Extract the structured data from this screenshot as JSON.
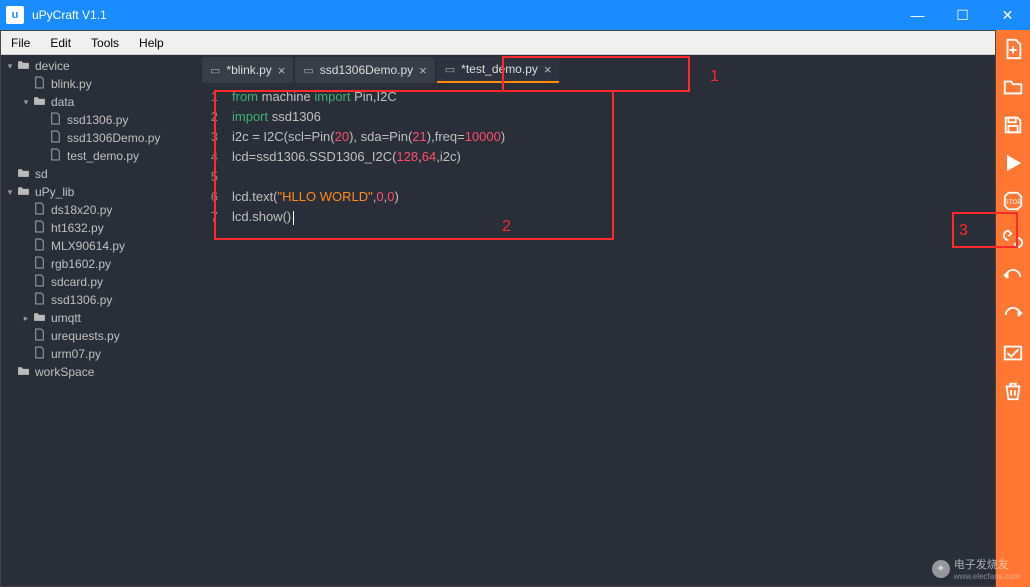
{
  "window": {
    "title": "uPyCraft V1.1",
    "controls": {
      "min": "—",
      "max": "☐",
      "close": "✕"
    }
  },
  "menu": [
    "File",
    "Edit",
    "Tools",
    "Help"
  ],
  "tree": [
    {
      "depth": 0,
      "arrow": "▾",
      "icon": "folder",
      "label": "device"
    },
    {
      "depth": 1,
      "arrow": "",
      "icon": "file",
      "label": "blink.py"
    },
    {
      "depth": 1,
      "arrow": "▾",
      "icon": "folder",
      "label": "data"
    },
    {
      "depth": 2,
      "arrow": "",
      "icon": "file",
      "label": "ssd1306.py"
    },
    {
      "depth": 2,
      "arrow": "",
      "icon": "file",
      "label": "ssd1306Demo.py"
    },
    {
      "depth": 2,
      "arrow": "",
      "icon": "file",
      "label": "test_demo.py"
    },
    {
      "depth": 0,
      "arrow": "",
      "icon": "folder",
      "label": "sd"
    },
    {
      "depth": 0,
      "arrow": "▾",
      "icon": "folder",
      "label": "uPy_lib"
    },
    {
      "depth": 1,
      "arrow": "",
      "icon": "file",
      "label": "ds18x20.py"
    },
    {
      "depth": 1,
      "arrow": "",
      "icon": "file",
      "label": "ht1632.py"
    },
    {
      "depth": 1,
      "arrow": "",
      "icon": "file",
      "label": "MLX90614.py"
    },
    {
      "depth": 1,
      "arrow": "",
      "icon": "file",
      "label": "rgb1602.py"
    },
    {
      "depth": 1,
      "arrow": "",
      "icon": "file",
      "label": "sdcard.py"
    },
    {
      "depth": 1,
      "arrow": "",
      "icon": "file",
      "label": "ssd1306.py"
    },
    {
      "depth": 1,
      "arrow": "▸",
      "icon": "folder",
      "label": "umqtt"
    },
    {
      "depth": 1,
      "arrow": "",
      "icon": "file",
      "label": "urequests.py"
    },
    {
      "depth": 1,
      "arrow": "",
      "icon": "file",
      "label": "urm07.py"
    },
    {
      "depth": 0,
      "arrow": "",
      "icon": "folder",
      "label": "workSpace"
    }
  ],
  "tabs": [
    {
      "label": "*blink.py",
      "active": false
    },
    {
      "label": "ssd1306Demo.py",
      "active": false
    },
    {
      "label": "*test_demo.py",
      "active": true
    }
  ],
  "code": {
    "lines": [
      [
        {
          "t": "from ",
          "c": "kw"
        },
        {
          "t": "machine ",
          "c": "id"
        },
        {
          "t": "import ",
          "c": "kw"
        },
        {
          "t": "Pin,I2C",
          "c": "id"
        }
      ],
      [
        {
          "t": "import ",
          "c": "kw"
        },
        {
          "t": "ssd1306",
          "c": "id"
        }
      ],
      [
        {
          "t": "i2c = I2C(scl=Pin(",
          "c": "id"
        },
        {
          "t": "20",
          "c": "num"
        },
        {
          "t": "), sda=Pin(",
          "c": "id"
        },
        {
          "t": "21",
          "c": "num"
        },
        {
          "t": "),freq=",
          "c": "id"
        },
        {
          "t": "10000",
          "c": "num"
        },
        {
          "t": ")",
          "c": "id"
        }
      ],
      [
        {
          "t": "lcd=ssd1306.SSD1306_I2C(",
          "c": "id"
        },
        {
          "t": "128",
          "c": "num"
        },
        {
          "t": ",",
          "c": "id"
        },
        {
          "t": "64",
          "c": "num"
        },
        {
          "t": ",i2c)",
          "c": "id"
        }
      ],
      [],
      [
        {
          "t": "lcd.text(",
          "c": "id"
        },
        {
          "t": "\"HLLO WORLD\"",
          "c": "str"
        },
        {
          "t": ",",
          "c": "id"
        },
        {
          "t": "0",
          "c": "num"
        },
        {
          "t": ",",
          "c": "id"
        },
        {
          "t": "0",
          "c": "num"
        },
        {
          "t": ")",
          "c": "id"
        }
      ],
      [
        {
          "t": "lcd.show()",
          "c": "id"
        }
      ]
    ]
  },
  "toolbar": [
    {
      "name": "new-file-icon"
    },
    {
      "name": "open-file-icon"
    },
    {
      "name": "save-icon"
    },
    {
      "name": "download-run-icon"
    },
    {
      "name": "stop-icon"
    },
    {
      "name": "connect-icon"
    },
    {
      "name": "undo-icon"
    },
    {
      "name": "redo-icon"
    },
    {
      "name": "check-icon"
    },
    {
      "name": "delete-icon"
    }
  ],
  "annotations": {
    "a1": "1",
    "a2": "2",
    "a3": "3"
  },
  "watermark": {
    "text": "电子发烧友",
    "sub": "www.elecfans.com"
  }
}
